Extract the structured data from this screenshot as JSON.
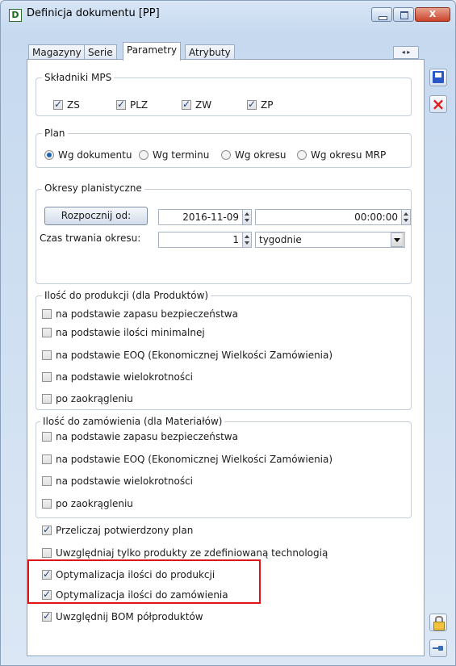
{
  "window": {
    "title": "Definicja dokumentu [PP]",
    "app_icon_letter": "D",
    "close_glyph": "X"
  },
  "tabs": [
    {
      "label": "Magazyny",
      "active": false
    },
    {
      "label": "Serie",
      "active": false
    },
    {
      "label": "Parametry",
      "active": true
    },
    {
      "label": "Atrybuty",
      "active": false
    }
  ],
  "tab_scroll": "◂ ▸",
  "mps": {
    "title": "Składniki MPS",
    "items": [
      {
        "label": "ZS",
        "checked": true
      },
      {
        "label": "PLZ",
        "checked": true
      },
      {
        "label": "ZW",
        "checked": true
      },
      {
        "label": "ZP",
        "checked": true
      }
    ]
  },
  "plan": {
    "title": "Plan",
    "options": [
      {
        "label": "Wg dokumentu",
        "selected": true
      },
      {
        "label": "Wg terminu",
        "selected": false
      },
      {
        "label": "Wg okresu",
        "selected": false
      },
      {
        "label": "Wg okresu MRP",
        "selected": false
      }
    ]
  },
  "okresy": {
    "title": "Okresy planistyczne",
    "start_button": "Rozpocznij od:",
    "start_date": "2016-11-09",
    "start_time": "00:00:00",
    "duration_label": "Czas trwania okresu:",
    "duration_value": "1",
    "duration_unit": "tygodnie"
  },
  "production": {
    "title": "Ilość do produkcji (dla Produktów)",
    "items": [
      {
        "label": "na podstawie zapasu bezpieczeństwa",
        "checked": false
      },
      {
        "label": "na podstawie ilości minimalnej",
        "checked": false
      },
      {
        "label": "na podstawie EOQ (Ekonomicznej Wielkości Zamówienia)",
        "checked": false
      },
      {
        "label": "na podstawie wielokrotności",
        "checked": false
      },
      {
        "label": "po zaokrągleniu",
        "checked": false
      }
    ]
  },
  "order": {
    "title": "Ilość do zamówienia (dla Materiałów)",
    "items": [
      {
        "label": "na podstawie zapasu bezpieczeństwa",
        "checked": false
      },
      {
        "label": "na podstawie EOQ (Ekonomicznej Wielkości Zamówienia)",
        "checked": false
      },
      {
        "label": "na podstawie wielokrotności",
        "checked": false
      },
      {
        "label": "po zaokrągleniu",
        "checked": false
      }
    ]
  },
  "options": [
    {
      "label": "Przeliczaj potwierdzony plan",
      "checked": true
    },
    {
      "label": "Uwzględniaj tylko produkty ze zdefiniowaną technologią",
      "checked": false
    },
    {
      "label": "Optymalizacja ilości do produkcji",
      "checked": true
    },
    {
      "label": "Optymalizacja ilości do zamówienia",
      "checked": true
    },
    {
      "label": "Uwzględnij BOM półproduktów",
      "checked": true
    }
  ],
  "colors": {
    "highlight": "#e01616",
    "check": "#1d3f88",
    "radio": "#1f63b7",
    "save": "#2a57c8",
    "close": "#e01b1b"
  },
  "icons": {
    "save": "save-icon",
    "close": "close-icon",
    "lock": "lock-icon",
    "pin": "pin-icon"
  }
}
